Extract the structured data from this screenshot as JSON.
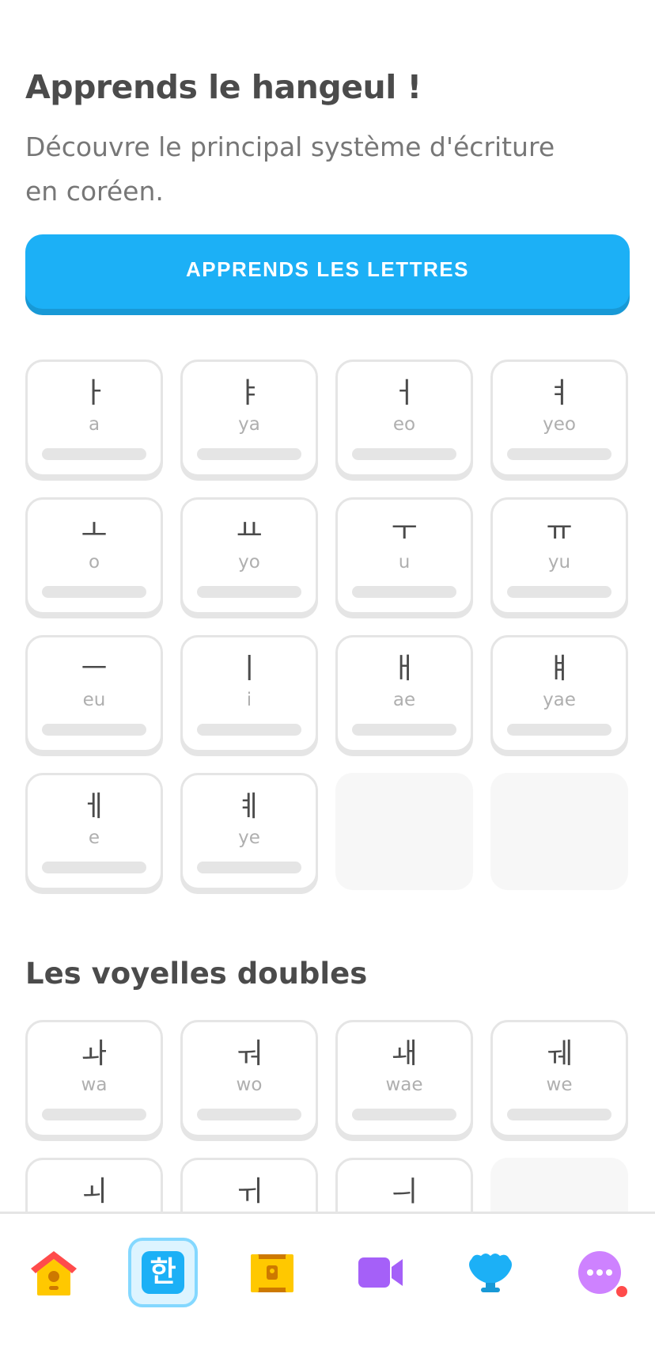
{
  "header": {
    "title": "Apprends le hangeul !",
    "subtitle": "Découvre le principal système d'écriture en coréen.",
    "cta_label": "APPRENDS LES LETTRES"
  },
  "vowels": [
    {
      "glyph": "ㅏ",
      "roman": "a"
    },
    {
      "glyph": "ㅑ",
      "roman": "ya"
    },
    {
      "glyph": "ㅓ",
      "roman": "eo"
    },
    {
      "glyph": "ㅕ",
      "roman": "yeo"
    },
    {
      "glyph": "ㅗ",
      "roman": "o"
    },
    {
      "glyph": "ㅛ",
      "roman": "yo"
    },
    {
      "glyph": "ㅜ",
      "roman": "u"
    },
    {
      "glyph": "ㅠ",
      "roman": "yu"
    },
    {
      "glyph": "ㅡ",
      "roman": "eu"
    },
    {
      "glyph": "ㅣ",
      "roman": "i"
    },
    {
      "glyph": "ㅐ",
      "roman": "ae"
    },
    {
      "glyph": "ㅒ",
      "roman": "yae"
    },
    {
      "glyph": "ㅔ",
      "roman": "e"
    },
    {
      "glyph": "ㅖ",
      "roman": "ye"
    }
  ],
  "double_vowels": {
    "title": "Les voyelles doubles",
    "items": [
      {
        "glyph": "ㅘ",
        "roman": "wa"
      },
      {
        "glyph": "ㅝ",
        "roman": "wo"
      },
      {
        "glyph": "ㅙ",
        "roman": "wae"
      },
      {
        "glyph": "ㅞ",
        "roman": "we"
      },
      {
        "glyph": "ㅚ",
        "roman": ""
      },
      {
        "glyph": "ㅟ",
        "roman": ""
      },
      {
        "glyph": "ㅢ",
        "roman": ""
      }
    ]
  },
  "nav": {
    "items": [
      {
        "icon": "home-icon"
      },
      {
        "icon": "hangeul-icon",
        "glyph": "한",
        "active": true
      },
      {
        "icon": "treasure-chest-icon"
      },
      {
        "icon": "video-camera-icon"
      },
      {
        "icon": "shell-icon"
      },
      {
        "icon": "more-icon",
        "notification": true
      }
    ]
  },
  "colors": {
    "accent": "#1cb0f6",
    "accent_shadow": "#1899d6",
    "card_border": "#e5e5e5",
    "muted_text": "#afafaf",
    "notification": "#ff4b4b"
  }
}
